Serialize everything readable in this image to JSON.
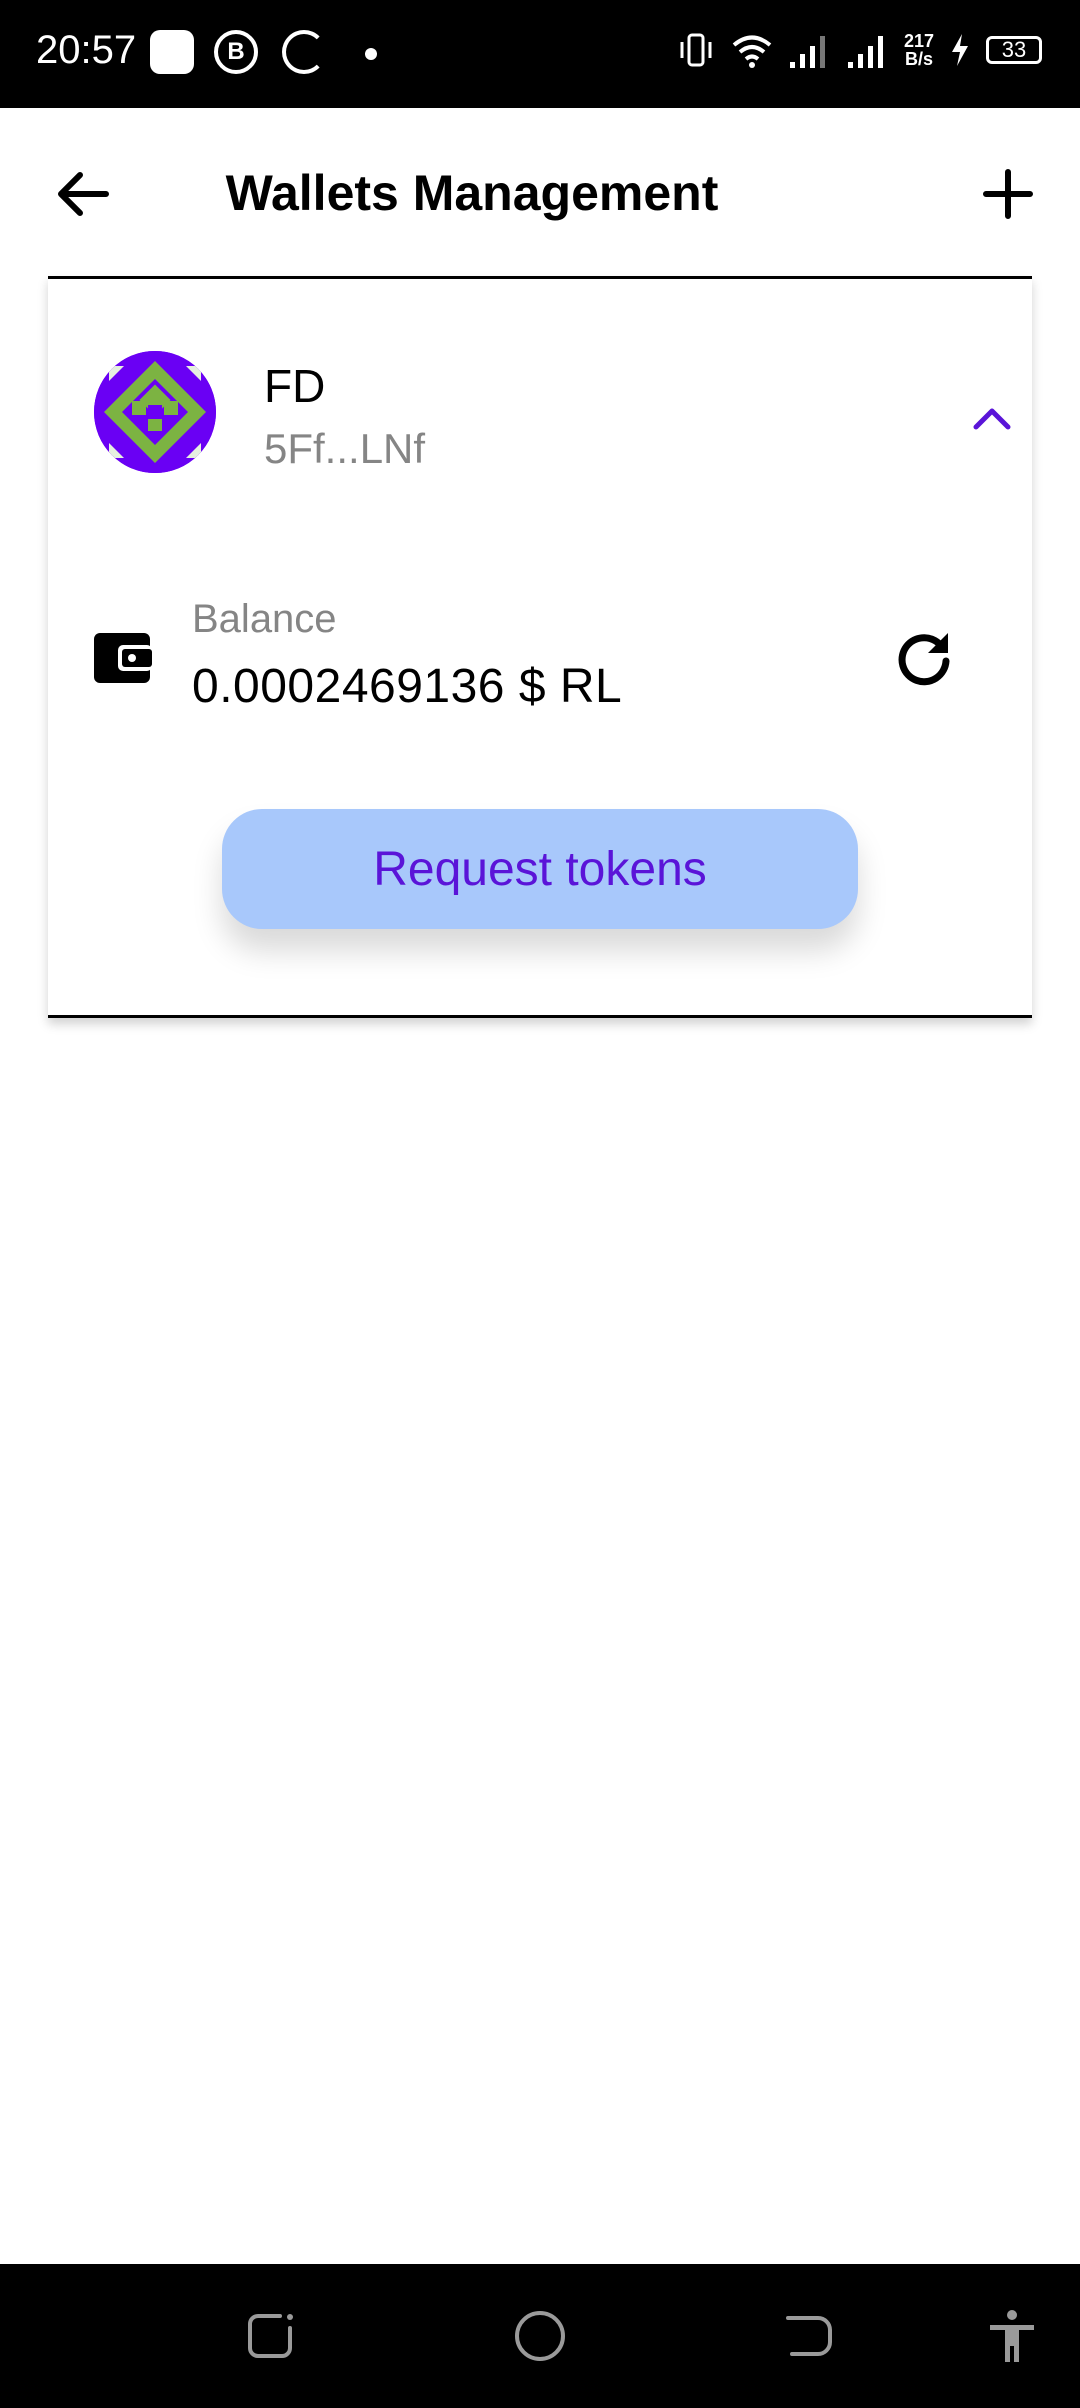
{
  "status_bar": {
    "time": "20:57",
    "app_b": "B",
    "net_speed_value": "217",
    "net_speed_unit": "B/s",
    "battery": "33"
  },
  "header": {
    "title": "Wallets Management"
  },
  "wallet": {
    "name": "FD",
    "address": "5Ff...LNf",
    "balance_label": "Balance",
    "balance_value": "0.0002469136 $ RL",
    "request_label": "Request tokens"
  },
  "icons": {
    "back": "arrow-left-icon",
    "add": "plus-icon",
    "collapse": "chevron-up-icon",
    "wallet": "wallet-icon",
    "refresh": "refresh-icon",
    "nav": [
      "recents-icon",
      "home-icon",
      "back-icon",
      "accessibility-icon"
    ]
  },
  "colors": {
    "accent": "#5a14d8",
    "button_bg": "#a8c8fb",
    "avatar_primary": "#6a00f4",
    "avatar_green": "#7cb342"
  }
}
